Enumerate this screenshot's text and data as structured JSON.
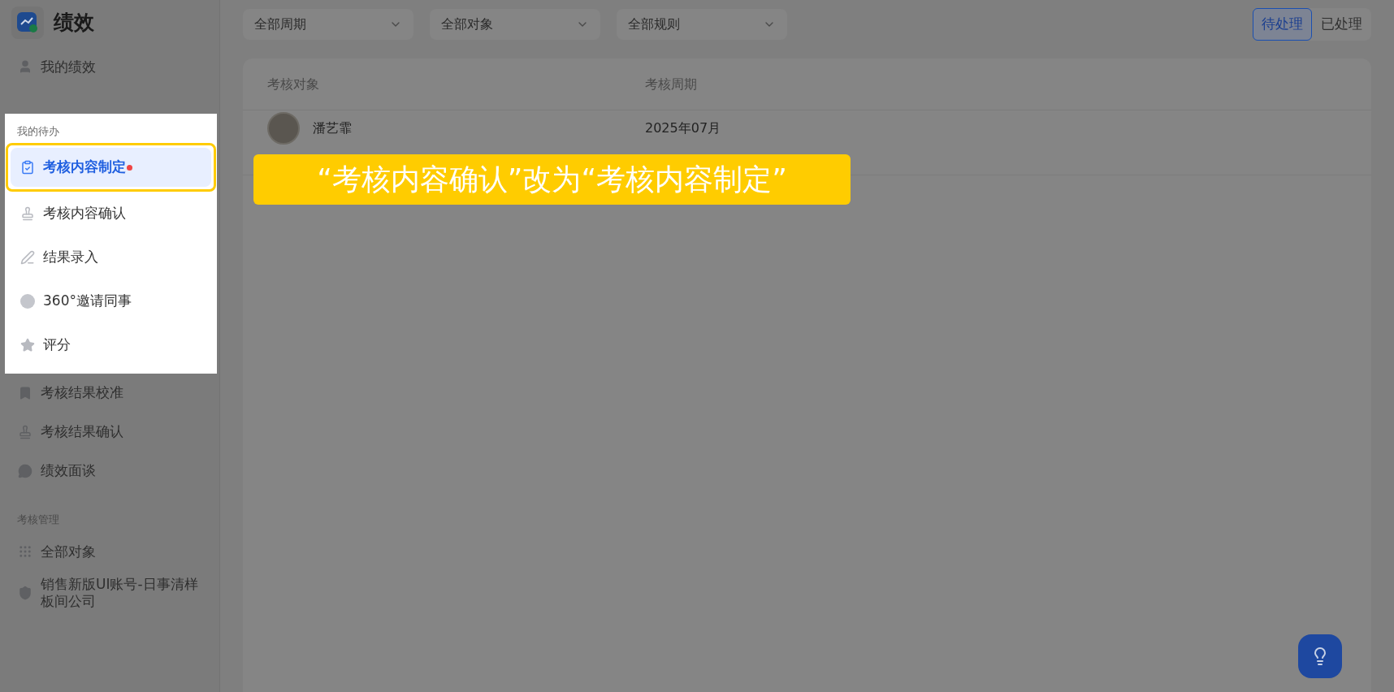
{
  "sidebar": {
    "title": "绩效",
    "items": [
      {
        "label": "我的绩效",
        "selected": false
      }
    ],
    "spotlight": {
      "label": "我的待办",
      "items": [
        {
          "label": "考核内容制定",
          "selected": true,
          "dot": true
        },
        {
          "label": "考核内容确认",
          "selected": false,
          "dot": false
        },
        {
          "label": "结果录入",
          "selected": false,
          "dot": false
        },
        {
          "label": "360°邀请同事",
          "selected": false,
          "dot": false
        },
        {
          "label": "评分",
          "selected": false,
          "dot": false
        }
      ]
    },
    "items_after": [
      {
        "label": "考核结果校准",
        "selected": false
      },
      {
        "label": "考核结果确认",
        "selected": false
      },
      {
        "label": "绩效面谈",
        "selected": false
      }
    ],
    "sections": [
      {
        "label": "考核管理",
        "items": [
          {
            "label": "全部对象",
            "selected": false
          },
          {
            "label": "销售新版UI账号-日事清样板间公司",
            "selected": false
          }
        ]
      }
    ]
  },
  "filters": [
    "全部周期",
    "全部对象",
    "全部规则"
  ],
  "status_tabs": [
    {
      "label": "待处理",
      "selected": true
    },
    {
      "label": "已处理",
      "selected": false
    }
  ],
  "table": {
    "columns": [
      "考核对象",
      "考核周期"
    ],
    "rows": [
      {
        "name": "潘艺霏",
        "period": "2025年07月"
      }
    ]
  },
  "annotation": {
    "text": "“考核内容确认”改为“考核内容制定”"
  }
}
